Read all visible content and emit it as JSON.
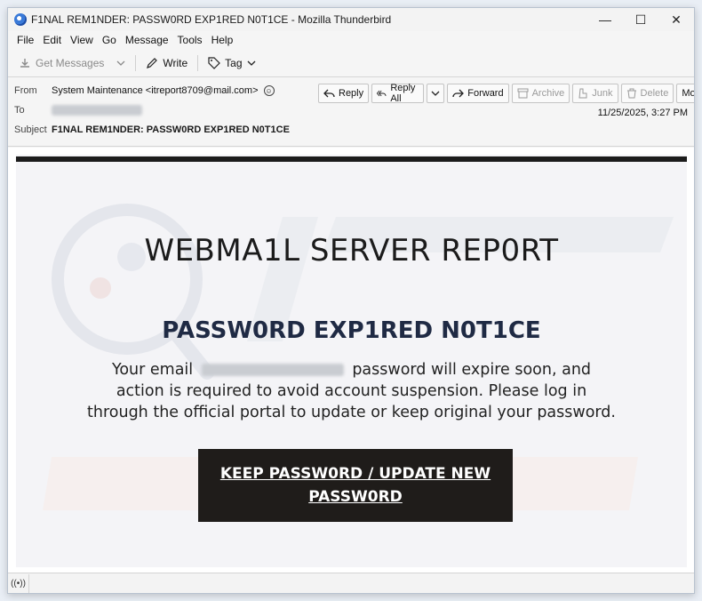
{
  "window": {
    "title": "F1NAL REM1NDER: PASSW0RD EXP1RED N0T1CE - Mozilla Thunderbird",
    "controls": {
      "minimize": "—",
      "maximize": "☐",
      "close": "✕"
    }
  },
  "menu": [
    "File",
    "Edit",
    "View",
    "Go",
    "Message",
    "Tools",
    "Help"
  ],
  "toolbar": {
    "get_messages": "Get Messages",
    "write": "Write",
    "tag": "Tag"
  },
  "header": {
    "from_label": "From",
    "from_value": "System Maintenance <itreport8709@mail.com>",
    "to_label": "To",
    "subject_label": "Subject",
    "subject_value": "F1NAL REM1NDER: PASSW0RD EXP1RED N0T1CE",
    "date": "11/25/2025, 3:27 PM",
    "actions": {
      "reply": "Reply",
      "reply_all": "Reply All",
      "forward": "Forward",
      "archive": "Archive",
      "junk": "Junk",
      "delete": "Delete",
      "more": "More"
    }
  },
  "email": {
    "title": "WEBMA1L SERVER REP0RT",
    "subtitle": "PASSW0RD EXP1RED N0T1CE",
    "body_prefix": "Your email",
    "body_suffix": "password will expire soon, and action is required to avoid account suspension. Please log in through the official portal to update or keep original your password.",
    "cta_label": "KEEP PASSW0RD / UPDATE NEW PASSW0RD"
  },
  "colors": {
    "cta_bg": "#1f1c1a",
    "subtitle": "#1f2a44",
    "email_bg": "#f4f4f7"
  }
}
